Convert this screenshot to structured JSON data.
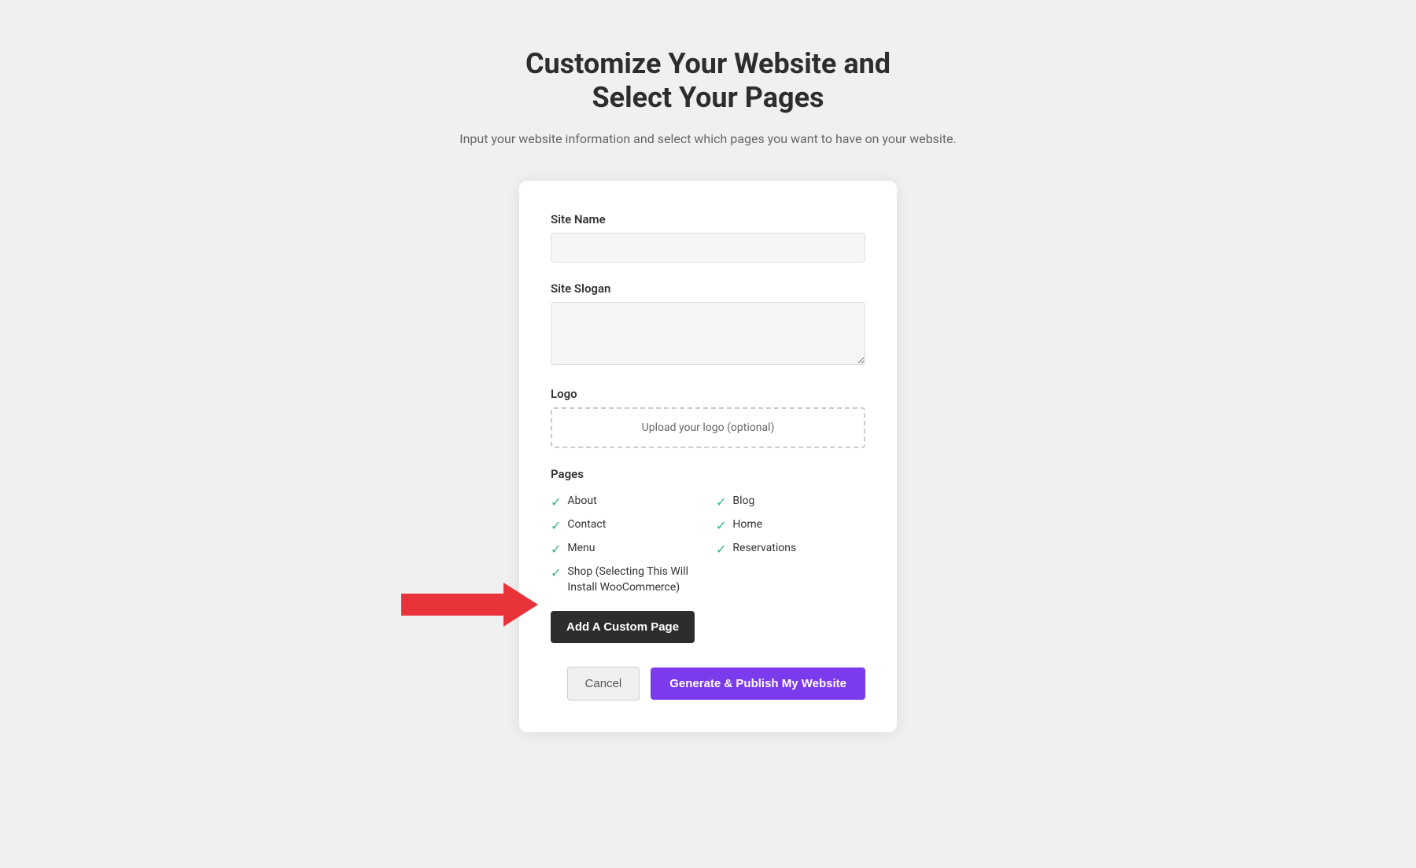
{
  "header": {
    "title_line1": "Customize Your Website and",
    "title_line2": "Select Your Pages",
    "subtitle": "Input your website information and select which pages you want to have on your website."
  },
  "form": {
    "site_name_label": "Site Name",
    "site_name_placeholder": "",
    "site_slogan_label": "Site Slogan",
    "site_slogan_placeholder": "",
    "logo_label": "Logo",
    "logo_upload_text": "Upload your logo (optional)",
    "pages_label": "Pages",
    "pages": [
      {
        "name": "About",
        "checked": true,
        "col": 1
      },
      {
        "name": "Blog",
        "checked": true,
        "col": 2
      },
      {
        "name": "Contact",
        "checked": true,
        "col": 1
      },
      {
        "name": "Home",
        "checked": true,
        "col": 2
      },
      {
        "name": "Menu",
        "checked": true,
        "col": 1
      },
      {
        "name": "Reservations",
        "checked": true,
        "col": 2
      },
      {
        "name": "Shop (Selecting This Will Install WooCommerce)",
        "checked": true,
        "col": 1,
        "wide": true
      }
    ],
    "add_custom_page_label": "Add A Custom Page",
    "cancel_label": "Cancel",
    "publish_label": "Generate & Publish My Website"
  },
  "colors": {
    "check": "#2bb57a",
    "add_btn_bg": "#2d2d2d",
    "add_btn_text": "#ffffff",
    "publish_bg": "#7c3aed",
    "publish_text": "#ffffff",
    "cancel_bg": "#f0f0f0",
    "cancel_text": "#555555",
    "arrow": "#e8333a"
  }
}
